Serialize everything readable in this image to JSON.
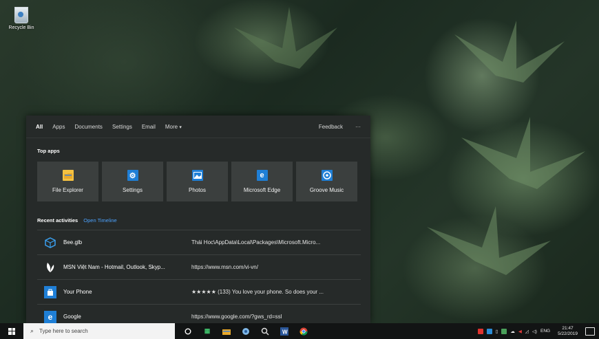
{
  "desktop": {
    "recycle_bin_label": "Recycle Bin"
  },
  "search_panel": {
    "tabs": [
      "All",
      "Apps",
      "Documents",
      "Settings",
      "Email",
      "More"
    ],
    "feedback": "Feedback",
    "more_options": "···",
    "top_apps_title": "Top apps",
    "top_apps": [
      {
        "name": "File Explorer",
        "icon": "folder-icon",
        "color": "#f5c242"
      },
      {
        "name": "Settings",
        "icon": "gear-icon",
        "color": "#1f7fd6"
      },
      {
        "name": "Photos",
        "icon": "photos-icon",
        "color": "#1f7fd6"
      },
      {
        "name": "Microsoft Edge",
        "icon": "edge-icon",
        "color": "#1f7fd6"
      },
      {
        "name": "Groove Music",
        "icon": "groove-icon",
        "color": "#1f7fd6"
      }
    ],
    "recent_title": "Recent activities",
    "open_timeline": "Open Timeline",
    "recent": [
      {
        "name": "Bee.glb",
        "path": "Thái Hoc\\AppData\\Local\\Packages\\Microsoft.Micro...",
        "icon": "3d-viewer-icon"
      },
      {
        "name": "MSN Việt Nam - Hotmail, Outlook, Skyp...",
        "path": "https://www.msn.com/vi-vn/",
        "icon": "msn-butterfly-icon"
      },
      {
        "name": "Your Phone",
        "path": "★★★★★ (133) You love your phone. So does your ...",
        "icon": "store-icon"
      },
      {
        "name": "Google",
        "path": "https://www.google.com/?gws_rd=ssl",
        "icon": "edge-icon"
      }
    ]
  },
  "taskbar": {
    "search_placeholder": "Type here to search",
    "tray_language": "ENG",
    "clock_time": "21:47",
    "clock_date": "5/22/2019"
  },
  "colors": {
    "panel_bg": "#262a29",
    "tile_bg": "#3b3f3e",
    "accent": "#1f7fd6",
    "link": "#4da3ff",
    "taskbar_bg": "#121414"
  }
}
